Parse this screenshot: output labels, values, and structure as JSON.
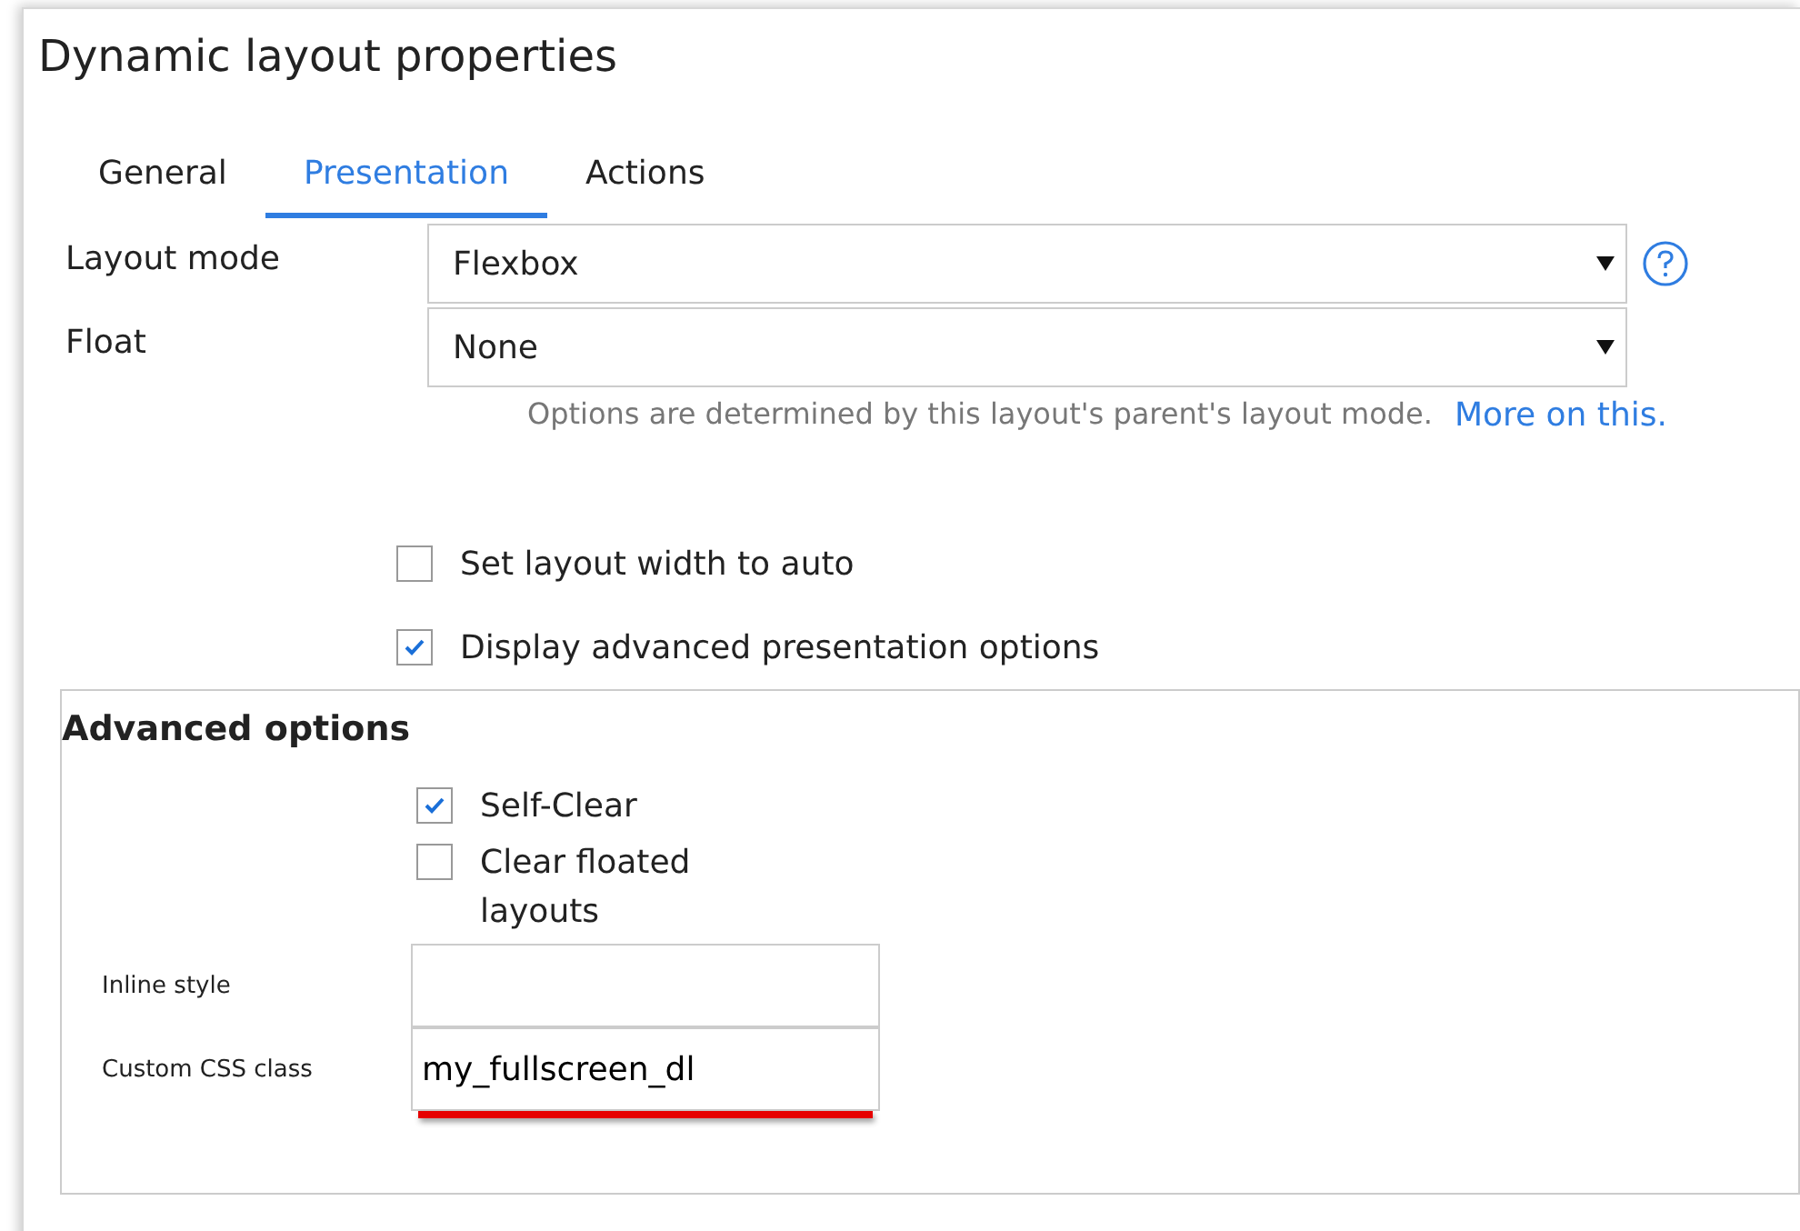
{
  "window": {
    "title": "Dynamic layout properties"
  },
  "tabs": [
    {
      "label": "General",
      "selected": false
    },
    {
      "label": "Presentation",
      "selected": true
    },
    {
      "label": "Actions",
      "selected": false
    }
  ],
  "fields": [
    {
      "label": "Layout mode",
      "value": "Flexbox",
      "help": true
    },
    {
      "label": "Float",
      "value": "None",
      "help": false
    }
  ],
  "hint": {
    "text": "Options are determined by this layout's parent's layout mode.",
    "link": "More on this."
  },
  "options": [
    {
      "label": "Set layout width to auto",
      "checked": false
    },
    {
      "label": "Display advanced presentation options",
      "checked": true
    }
  ],
  "advanced": {
    "title": "Advanced options",
    "options": [
      {
        "label": "Self-Clear",
        "checked": true
      },
      {
        "label": "Clear floated layouts",
        "checked": false
      }
    ],
    "inputs": [
      {
        "label": "Inline style",
        "underlined": false
      },
      {
        "label": "Custom CSS class",
        "value": "my_fullscreen_dl",
        "underlined": true
      }
    ]
  }
}
